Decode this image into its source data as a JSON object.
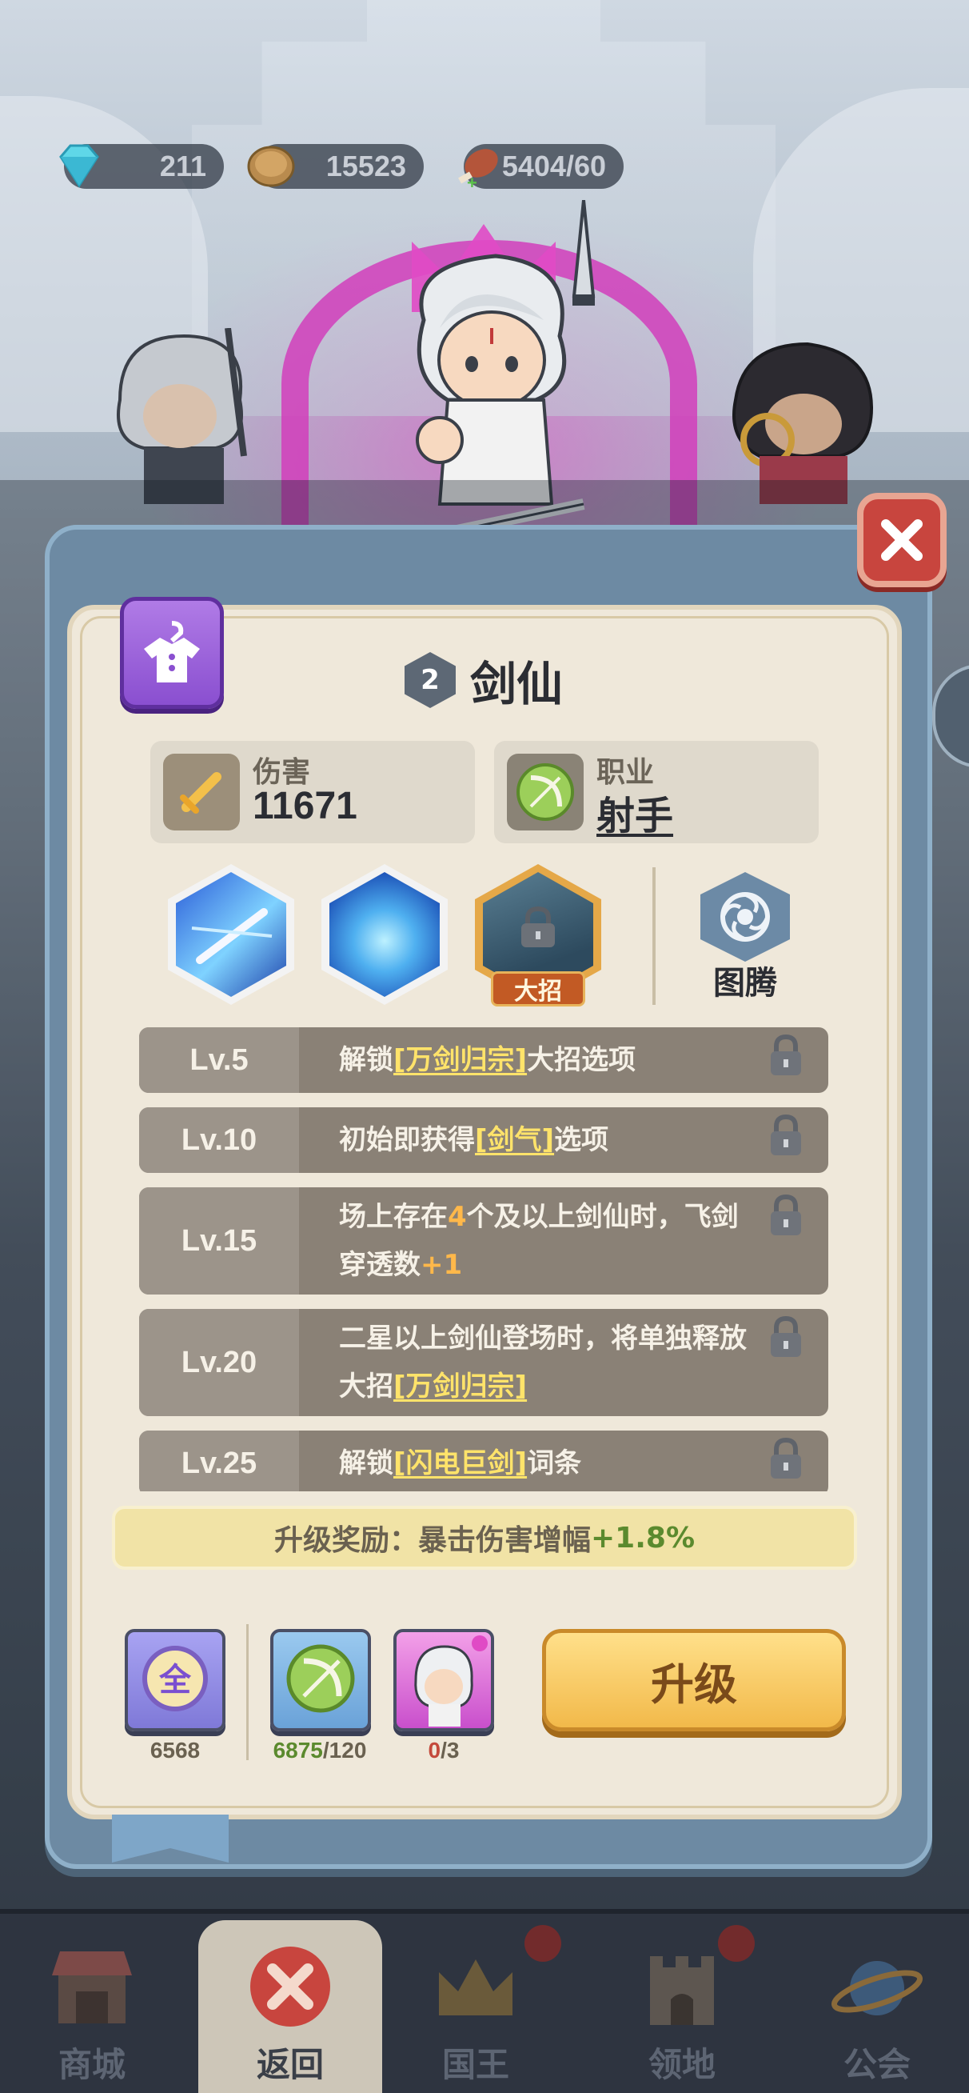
{
  "resources": {
    "gems": "211",
    "coins": "15523",
    "stamina": "5404/60"
  },
  "hero": {
    "star_level": "2",
    "name": "剑仙"
  },
  "stats": {
    "damage_label": "伤害",
    "damage_value": "11671",
    "class_label": "职业",
    "class_value": "射手"
  },
  "skills": {
    "ultimate_tag": "大招",
    "totem_label": "图腾"
  },
  "level_rows": [
    {
      "lv": "Lv.5",
      "pre": "解锁",
      "hl": "[万剑归宗]",
      "post": "大招选项"
    },
    {
      "lv": "Lv.10",
      "pre": "初始即获得",
      "hl": "[剑气]",
      "post": "选项"
    },
    {
      "lv": "Lv.15",
      "pre": "场上存在",
      "num1": "4",
      "mid": "个及以上剑仙时，飞剑穿透数",
      "num2": "+1"
    },
    {
      "lv": "Lv.20",
      "pre": "二星以上剑仙登场时，将单独释放大招",
      "hl": "[万剑归宗]"
    },
    {
      "lv": "Lv.25",
      "pre": "解锁",
      "hl": "[闪电巨剑]",
      "post": "词条"
    }
  ],
  "reward": {
    "label": "升级奖励：暴击伤害增幅",
    "value": "+1.8%"
  },
  "items": {
    "all_glyph": "全",
    "all_count": "6568",
    "bow_have": "6875",
    "bow_need": "/120",
    "card_have": "0",
    "card_need": "/3"
  },
  "upgrade_label": "升级",
  "nav": {
    "shop": "商城",
    "back": "返回",
    "king": "国王",
    "land": "领地",
    "guild": "公会"
  },
  "colors": {
    "panel": "#6d8aa3",
    "parchment": "#efe8da",
    "upgrade": "#f2b94a",
    "highlight": "#ffe36a",
    "close": "#c8453e"
  }
}
